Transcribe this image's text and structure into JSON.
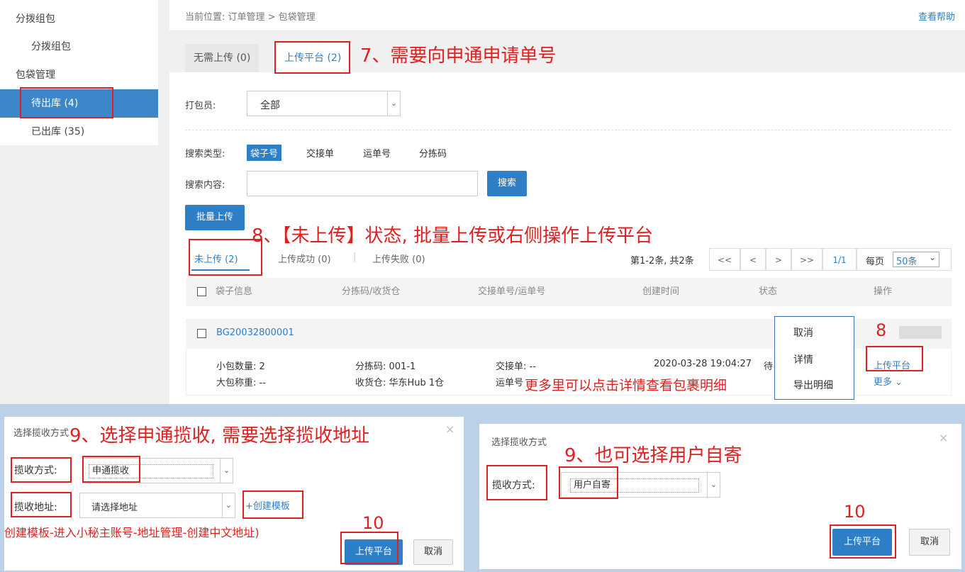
{
  "sidebar": {
    "items": [
      {
        "label": "分拨组包"
      },
      {
        "label": "分拨组包"
      },
      {
        "label": "包袋管理"
      },
      {
        "label": "待出库 (4)"
      },
      {
        "label": "已出库 (35)"
      }
    ]
  },
  "header": {
    "breadcrumb": "当前位置:  订单管理 > 包袋管理",
    "help": "查看帮助"
  },
  "tabs": {
    "no_upload": "无需上传 (0)",
    "upload_platform": "上传平台 (2)"
  },
  "filters": {
    "packer_label": "打包员:",
    "packer_value": "全部",
    "search_type_label": "搜索类型:",
    "search_types": [
      "袋子号",
      "交接单",
      "运单号",
      "分拣码"
    ],
    "search_content_label": "搜索内容:",
    "search_value": "",
    "search_button": "搜索",
    "batch_button": "批量上传"
  },
  "status_tabs": {
    "not_uploaded": "未上传 (2)",
    "upload_success": "上传成功 (0)",
    "upload_failed": "上传失败 (0)"
  },
  "pagination": {
    "summary": "第1-2条, 共2条",
    "first": "<<",
    "prev": "<",
    "next": ">",
    "last": ">>",
    "page": "1/1",
    "per_page_label": "每页",
    "per_page_value": "50条"
  },
  "table": {
    "headers": [
      "袋子信息",
      "分拣码/收货仓",
      "交接单号/运单号",
      "创建时间",
      "状态",
      "操作"
    ],
    "row": {
      "bag_id": "BG20032800001",
      "small_count": "小包数量: 2",
      "big_weight": "大包称重: --",
      "sort_code": "分拣码: 001-1",
      "warehouse": "收货仓: 华东Hub 1仓",
      "handover": "交接单: --",
      "waybill": "运单号",
      "created": "2020-03-28 19:04:27",
      "status": "待",
      "action_upload": "上传平台",
      "action_more": "更多"
    }
  },
  "more_menu": {
    "items": [
      "取消",
      "详情",
      "导出明细"
    ]
  },
  "annotations": {
    "a7": "7、需要向申通申请单号",
    "a8": "8、【未上传】状态, 批量上传或右侧操作上传平台",
    "a8b": "8",
    "a_more": "更多里可以点击详情查看包裹明细",
    "a9_left": "9、选择申通揽收, 需要选择揽收地址",
    "a9_right": "9、也可选择用户自寄",
    "a10_left": "10",
    "a10_right": "10",
    "template_note": "创建模板-进入小秘主账号-地址管理-创建中文地址)"
  },
  "dialog_left": {
    "title": "选择揽收方式",
    "method_label": "揽收方式:",
    "method_value": "申通揽收",
    "address_label": "揽收地址:",
    "address_placeholder": "请选择地址",
    "create_template": "+创建模板",
    "confirm": "上传平台",
    "cancel": "取消"
  },
  "dialog_right": {
    "title": "选择揽收方式",
    "method_label": "揽收方式:",
    "method_value": "用户自寄",
    "confirm": "上传平台",
    "cancel": "取消"
  },
  "colors": {
    "accent": "#2f7fc6",
    "annotation": "#e02020",
    "sidebar_selected": "#3d86c9"
  }
}
